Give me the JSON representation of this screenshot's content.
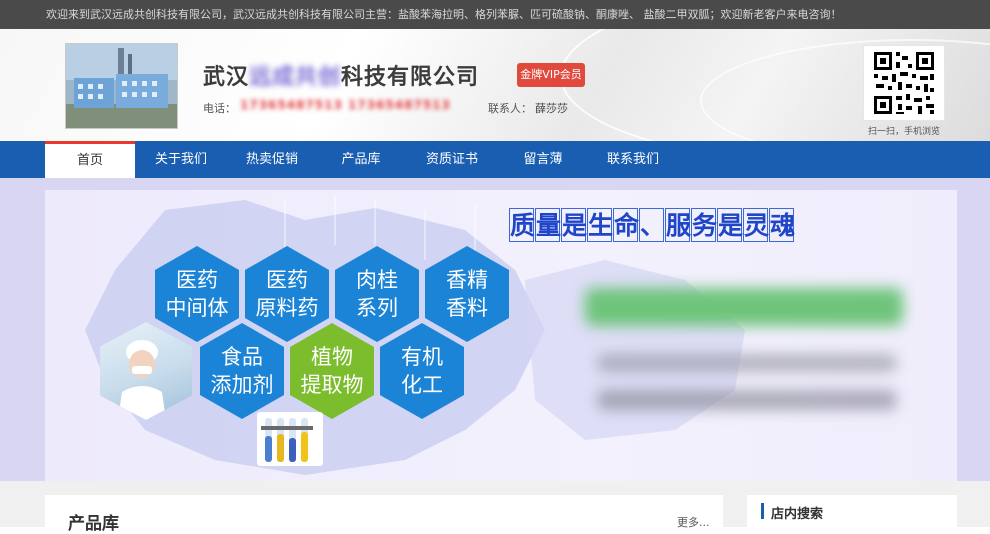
{
  "topbar": {
    "text": "欢迎来到武汉远成共创科技有限公司，武汉远成共创科技有限公司主营：盐酸苯海拉明、格列苯脲、匹可硫酸钠、酮康唑、 盐酸二甲双胍；欢迎新老客户来电咨询！"
  },
  "header": {
    "company_prefix": "武汉",
    "company_blurred": "远成共创",
    "company_suffix": "科技有限公司",
    "vip_badge": "金牌VIP会员",
    "phone_label": "电话：",
    "phone_value": "17365487513 17365487513",
    "contact_label": "联系人：",
    "contact_value": "薛莎莎",
    "qr_caption": "扫一扫，手机浏览"
  },
  "nav": {
    "items": [
      {
        "label": "首页",
        "active": true
      },
      {
        "label": "关于我们"
      },
      {
        "label": "热卖促销"
      },
      {
        "label": "产品库"
      },
      {
        "label": "资质证书"
      },
      {
        "label": "留言薄"
      },
      {
        "label": "联系我们"
      }
    ]
  },
  "banner": {
    "slogan": [
      "质",
      "量",
      "是",
      "生",
      "命",
      "、",
      "服",
      "务",
      "是",
      "灵",
      "魂"
    ],
    "hexes": [
      {
        "l1": "医药",
        "l2": "中间体",
        "color": "#1c84d6"
      },
      {
        "l1": "医药",
        "l2": "原料药",
        "color": "#1c84d6"
      },
      {
        "l1": "肉桂",
        "l2": "系列",
        "color": "#1c84d6"
      },
      {
        "l1": "香精",
        "l2": "香料",
        "color": "#1c84d6"
      },
      {
        "l1": "食品",
        "l2": "添加剂",
        "color": "#1c84d6"
      },
      {
        "l1": "植物",
        "l2": "提取物",
        "color": "#7cbd2e"
      },
      {
        "l1": "有机",
        "l2": "化工",
        "color": "#1c84d6"
      }
    ]
  },
  "content": {
    "products_title": "产品库",
    "more_label": "更多...",
    "search_title": "店内搜索"
  }
}
